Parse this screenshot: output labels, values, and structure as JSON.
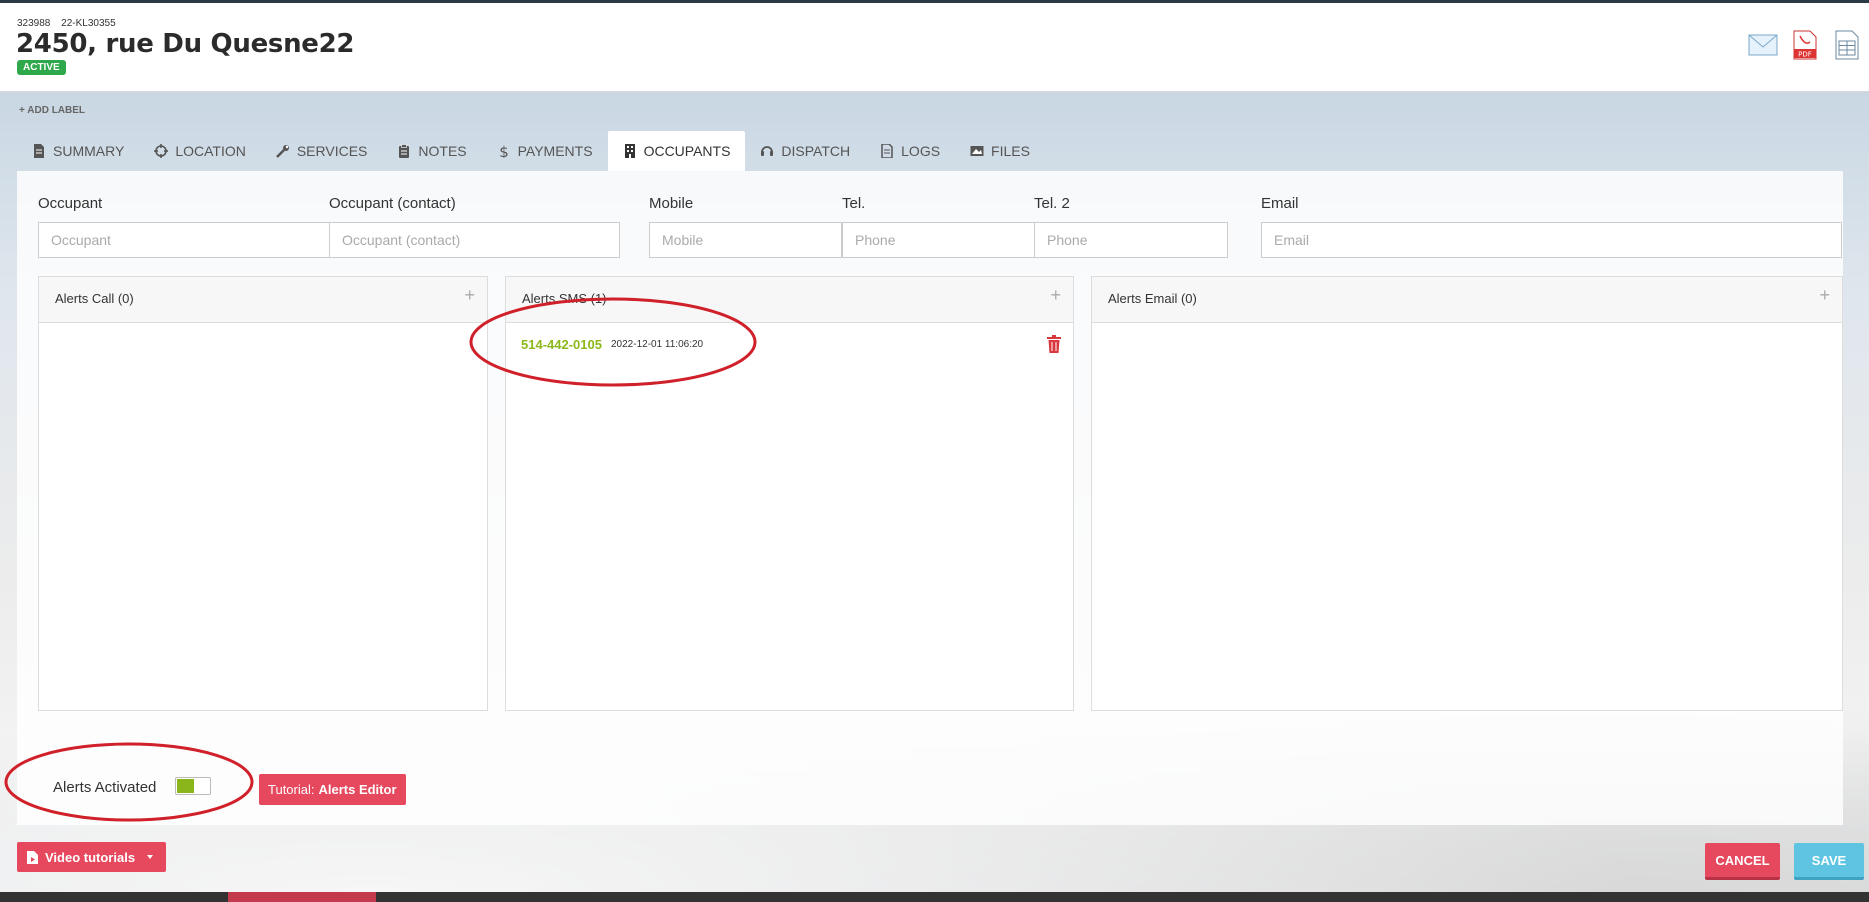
{
  "header": {
    "ids": [
      "323988",
      "22-KL30355"
    ],
    "title": "2450, rue Du Quesne22",
    "status": "ACTIVE",
    "status_color": "#2ea84a",
    "icons": [
      "email-icon",
      "pdf-icon",
      "spreadsheet-icon"
    ]
  },
  "add_label": "+ ADD LABEL",
  "tabs": [
    {
      "label": "SUMMARY",
      "icon": "document-icon"
    },
    {
      "label": "LOCATION",
      "icon": "crosshair-icon"
    },
    {
      "label": "SERVICES",
      "icon": "wrench-icon"
    },
    {
      "label": "NOTES",
      "icon": "clipboard-icon"
    },
    {
      "label": "PAYMENTS",
      "icon": "dollar-icon"
    },
    {
      "label": "OCCUPANTS",
      "icon": "building-icon",
      "active": true
    },
    {
      "label": "DISPATCH",
      "icon": "headset-icon"
    },
    {
      "label": "LOGS",
      "icon": "log-icon"
    },
    {
      "label": "FILES",
      "icon": "image-icon"
    }
  ],
  "form": {
    "occupant": {
      "label": "Occupant",
      "placeholder": "Occupant",
      "value": ""
    },
    "occupant_contact": {
      "label": "Occupant (contact)",
      "placeholder": "Occupant (contact)",
      "value": ""
    },
    "mobile": {
      "label": "Mobile",
      "placeholder": "Mobile",
      "value": ""
    },
    "tel": {
      "label": "Tel.",
      "placeholder": "Phone",
      "value": ""
    },
    "tel2": {
      "label": "Tel. 2",
      "placeholder": "Phone",
      "value": ""
    },
    "email": {
      "label": "Email",
      "placeholder": "Email",
      "value": ""
    }
  },
  "alerts": {
    "call": {
      "title": "Alerts Call (0)",
      "items": []
    },
    "sms": {
      "title": "Alerts SMS (1)",
      "items": [
        {
          "phone": "514-442-0105",
          "time": "2022-12-01 11:06:20"
        }
      ]
    },
    "email": {
      "title": "Alerts Email (0)",
      "items": []
    }
  },
  "alerts_activated_label": "Alerts Activated",
  "alerts_activated": true,
  "tutorial": {
    "prefix": "Tutorial:",
    "name": "Alerts Editor"
  },
  "footer": {
    "video_label": "Video tutorials",
    "cancel_label": "CANCEL",
    "save_label": "SAVE"
  },
  "colors": {
    "accent_red": "#e6485e",
    "accent_blue": "#5ec4e2",
    "toggle_green": "#8ab51b",
    "phone_green": "#8cb81c"
  }
}
